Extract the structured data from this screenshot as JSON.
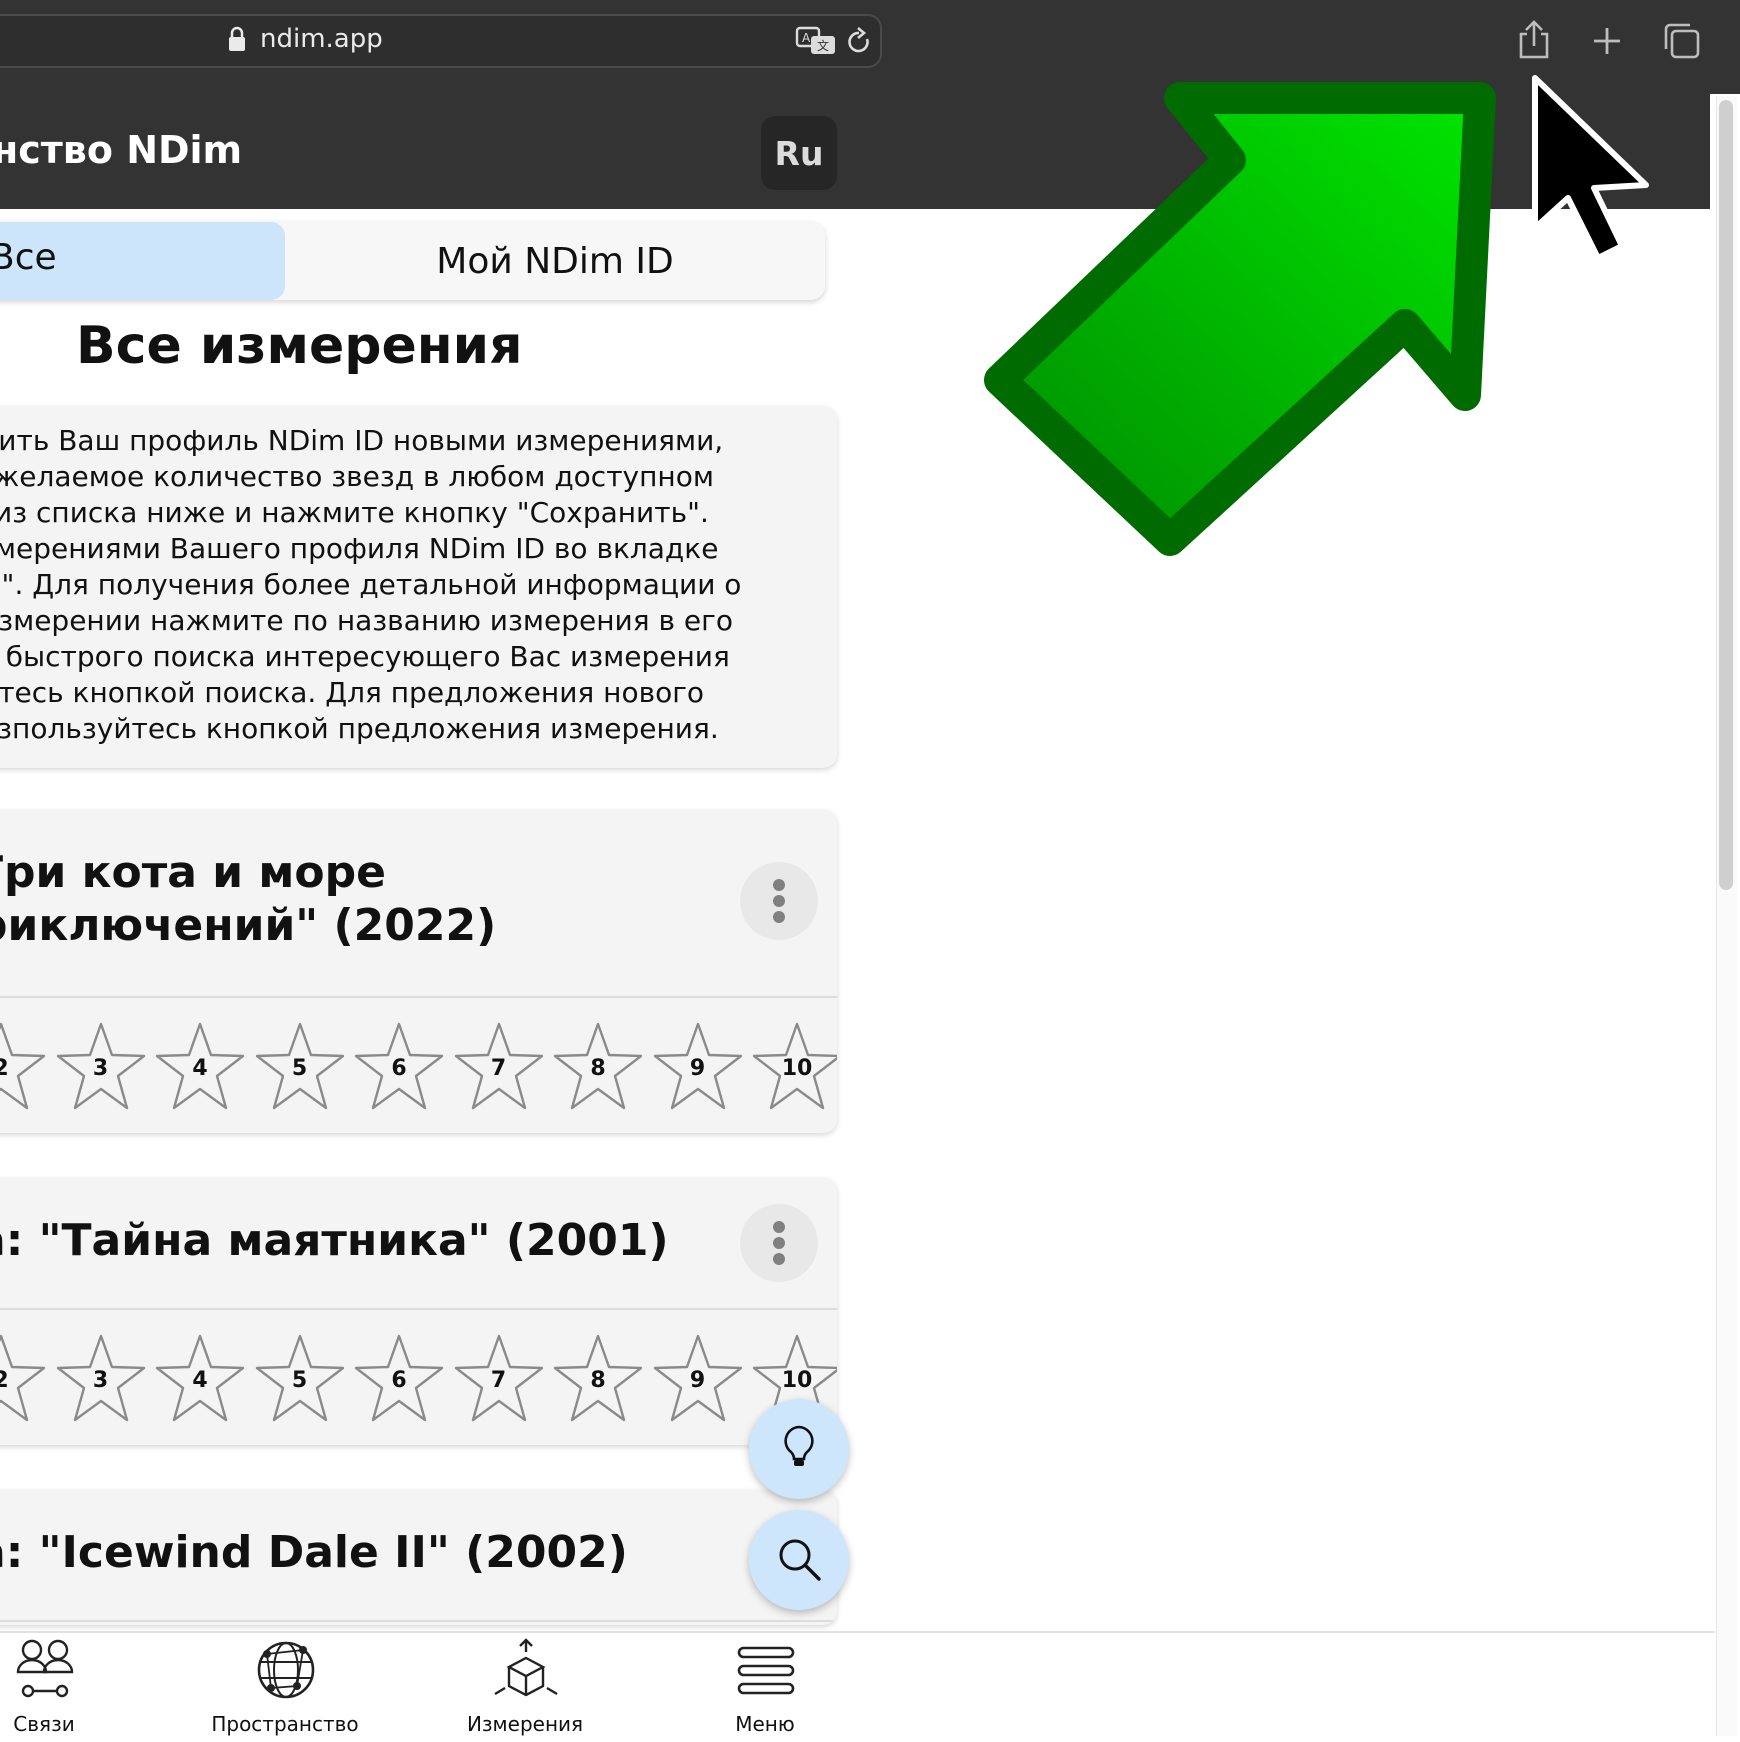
{
  "browser": {
    "url": "ndim.app",
    "icons": [
      "lock-icon",
      "translate-icon",
      "reload-icon",
      "share-icon",
      "new-tab-plus-icon",
      "tabs-overview-icon"
    ]
  },
  "app": {
    "title": "нство NDim",
    "lang_button": "Ru"
  },
  "tabs": {
    "all": "Все",
    "my_id": "Мой NDim ID"
  },
  "heading": "Все измерения",
  "info_lines": [
    "нить Ваш профиль NDim ID новыми измерениями,",
    " желаемое количество звезд в любом доступном",
    "  из списка ниже и нажмите кнопку \"Сохранить\".",
    "змерениями Вашего профиля NDim ID во вкладке",
    "D\". Для получения более детальной информации о",
    "измерении нажмите по названию измерения в его",
    "я быстрого поиска интересующего Вас измерения",
    "йтесь кнопкой поиска. Для предложения нового",
    "озпользуйтесь кнопкой предложения измерения."
  ],
  "cards": [
    {
      "title_lines": [
        "Гри кота и море",
        "риключений\" (2022)"
      ]
    },
    {
      "title_lines": [
        "а: \"Тайна маятника\" (2001)"
      ]
    },
    {
      "title_lines": [
        "а: \"Icewind Dale II\" (2002)"
      ]
    }
  ],
  "star_labels": [
    "2",
    "3",
    "4",
    "5",
    "6",
    "7",
    "8",
    "9",
    "10"
  ],
  "nav": [
    {
      "label": "Связи",
      "icon": "people-icon"
    },
    {
      "label": "Пространство",
      "icon": "globe-network-icon"
    },
    {
      "label": "Измерения",
      "icon": "cube-dimensions-icon"
    },
    {
      "label": "Меню",
      "icon": "menu-icon"
    }
  ],
  "fabs": [
    "lightbulb-icon",
    "search-icon"
  ],
  "colors": {
    "browser_bar": "#333333",
    "tab_selected": "#cce5fb",
    "card_bg": "#f4f4f4",
    "fab_bg": "#cde6fb",
    "arrow_green": "#00b800",
    "arrow_outline": "#006b00"
  }
}
